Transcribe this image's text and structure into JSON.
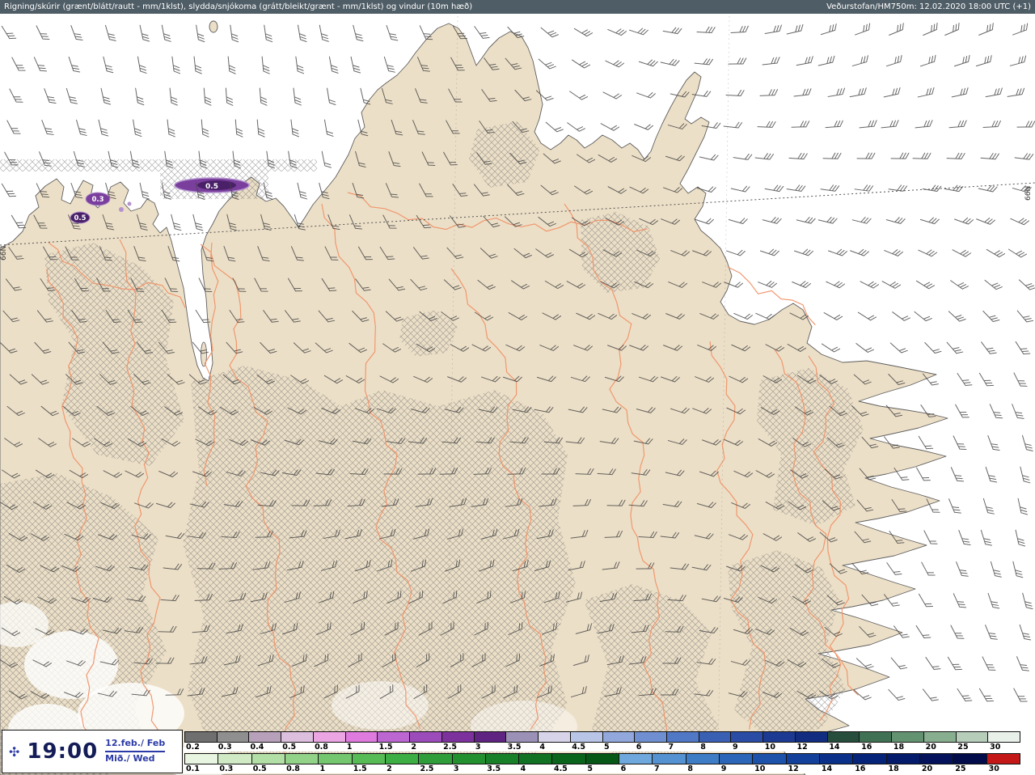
{
  "header": {
    "left": "Rigning/skúrir (grænt/blátt/rautt - mm/1klst), slydda/snjókoma (grátt/bleikt/grænt - mm/1klst) og vindur (10m hæð)",
    "right": "Veðurstofan/HM750m: 12.02.2020 18:00 UTC (+1)"
  },
  "map": {
    "lat_label": "66N",
    "precip_labels": {
      "blob1": "0.5",
      "blob2": "0.3",
      "blob3": "0.5"
    }
  },
  "time_panel": {
    "icon": "✣",
    "time": "19:00",
    "date": "12.feb./ Feb",
    "day": "Mið./ Wed"
  },
  "colors": {
    "header_bg": "#4f5d66",
    "sea": "#ffffff",
    "land": "#ecdfc7",
    "contour": "#f0946a",
    "barb": "#454545",
    "hatch": "#6f6f6f",
    "accent_blue": "#2b3aa6",
    "blob_dark": "#4a2168",
    "blob_mid": "#7a3f9d",
    "blob_light": "#b493cf"
  },
  "scales": {
    "sleet_snow": {
      "values": [
        "0.2",
        "0.3",
        "0.4",
        "0.5",
        "0.8",
        "1",
        "1.5",
        "2",
        "2.5",
        "3",
        "3.5",
        "4",
        "4.5",
        "5",
        "6",
        "7",
        "8",
        "9",
        "10",
        "12",
        "14",
        "16",
        "18",
        "20",
        "25",
        "30"
      ],
      "colors": [
        "#6f6f6f",
        "#8f8f8f",
        "#b7a0ba",
        "#dcbede",
        "#eaa5e2",
        "#df7bdf",
        "#bb66d1",
        "#9c4cba",
        "#7d319d",
        "#5f2381",
        "#9b91b6",
        "#d7d3e8",
        "#b8c5e6",
        "#92a8dc",
        "#6f8fd0",
        "#5078c4",
        "#3a60b4",
        "#2a4ca4",
        "#1c3a92",
        "#122c80",
        "#274e3c",
        "#417154",
        "#639270",
        "#88ae90",
        "#b6cdba",
        "#e8f0e9"
      ]
    },
    "rain": {
      "values": [
        "0.1",
        "0.3",
        "0.5",
        "0.8",
        "1",
        "1.5",
        "2",
        "2.5",
        "3",
        "3.5",
        "4",
        "4.5",
        "5",
        "6",
        "7",
        "8",
        "9",
        "10",
        "12",
        "14",
        "16",
        "18",
        "20",
        "25",
        "30"
      ],
      "colors": [
        "#e8f5e0",
        "#cfeac4",
        "#b2dfa6",
        "#93d389",
        "#74c76e",
        "#57bb56",
        "#3dae44",
        "#2f9e3a",
        "#23902f",
        "#188028",
        "#107222",
        "#0a641c",
        "#075817",
        "#6fa8dc",
        "#5592d2",
        "#3e7cc6",
        "#2b66b8",
        "#1c52aa",
        "#12409a",
        "#0b308a",
        "#06237a",
        "#041a6a",
        "#03125a",
        "#020c4a",
        "#c41818"
      ]
    }
  }
}
